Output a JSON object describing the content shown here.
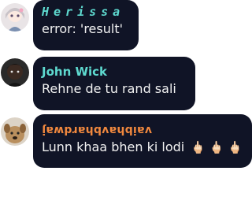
{
  "messages": [
    {
      "username": "Herissa",
      "text": "error: 'result'",
      "avatar": "anime-girl-avatar"
    },
    {
      "username": "John Wick",
      "text": "Rehne de tu rand sali",
      "avatar": "dark-portrait-avatar"
    },
    {
      "username": "vaibhavbhardwaj",
      "text": "Lunn khaa bhen ki lodi",
      "emojis": "🖕🏻 🖕🏻 🖕🏻",
      "avatar": "dog-avatar"
    }
  ],
  "colors": {
    "bubble": "#101426",
    "username_teal": "#5ed9cf",
    "username_orange": "#f0883e",
    "text": "#f2f2f2"
  }
}
